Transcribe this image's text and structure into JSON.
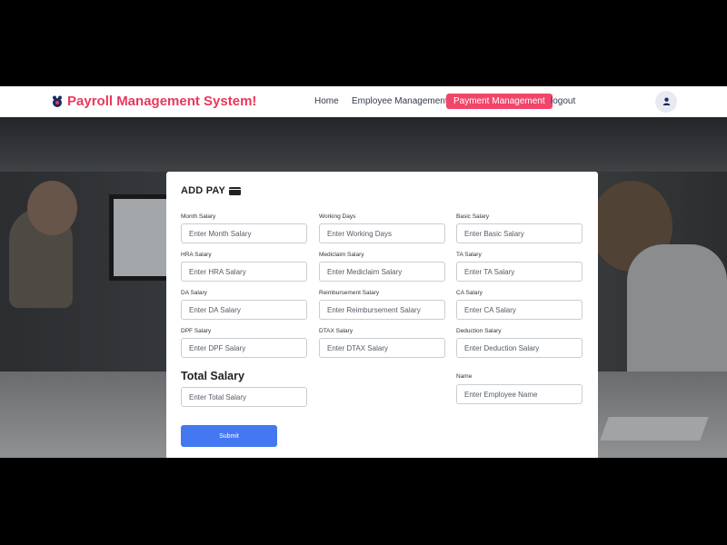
{
  "navbar": {
    "brand_title": "Payroll Management System!",
    "links": [
      "Home",
      "Employee Management",
      "Payment Management",
      "logout"
    ],
    "active_link": "Payment Management"
  },
  "form": {
    "title": "ADD PAY",
    "fields": [
      {
        "label": "Month Salary",
        "placeholder": "Enter Month Salary"
      },
      {
        "label": "Working Days",
        "placeholder": "Enter Working Days"
      },
      {
        "label": "Basic Salary",
        "placeholder": "Enter Basic Salary"
      },
      {
        "label": "HRA Salary",
        "placeholder": "Enter HRA Salary"
      },
      {
        "label": "Mediclaim Salary",
        "placeholder": "Enter Mediclaim Salary"
      },
      {
        "label": "TA Salary",
        "placeholder": "Enter TA Salary"
      },
      {
        "label": "DA Salary",
        "placeholder": "Enter DA Salary"
      },
      {
        "label": "Reimbursement Salary",
        "placeholder": "Enter Reimbursement Salary"
      },
      {
        "label": "CA Salary",
        "placeholder": "Enter CA Salary"
      },
      {
        "label": "DPF Salary",
        "placeholder": "Enter DPF Salary"
      },
      {
        "label": "DTAX Salary",
        "placeholder": "Enter DTAX Salary"
      },
      {
        "label": "Deduction Salary",
        "placeholder": "Enter Deduction Salary"
      }
    ],
    "total_title": "Total Salary",
    "total_placeholder": "Enter Total Salary",
    "name_label": "Name",
    "name_placeholder": "Enter Employee Name",
    "submit_label": "Submit"
  },
  "colors": {
    "brand": "#e8385b",
    "active_nav": "#f2456a",
    "submit": "#4378f0"
  }
}
